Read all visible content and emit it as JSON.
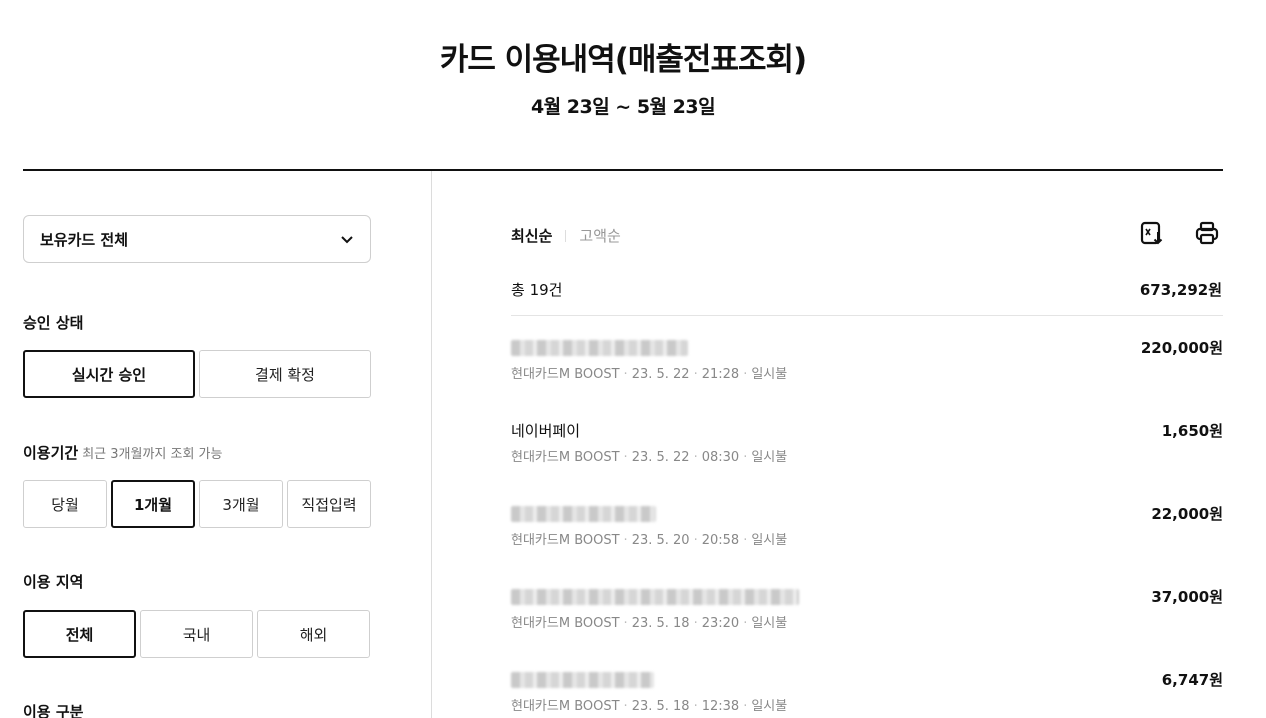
{
  "header": {
    "title": "카드 이용내역(매출전표조회)",
    "period": "4월 23일 ~ 5월 23일"
  },
  "sidebar": {
    "card_select": {
      "value": "보유카드 전체",
      "icon": "chevron-down-icon"
    },
    "approval": {
      "label": "승인 상태",
      "options": [
        "실시간 승인",
        "결제 확정"
      ],
      "selected": "실시간 승인"
    },
    "period": {
      "label": "이용기간",
      "hint": "최근 3개월까지 조회 가능",
      "options": [
        "당월",
        "1개월",
        "3개월",
        "직접입력"
      ],
      "selected": "1개월"
    },
    "region": {
      "label": "이용 지역",
      "options": [
        "전체",
        "국내",
        "해외"
      ],
      "selected": "전체"
    },
    "usage_type": {
      "label": "이용 구분"
    }
  },
  "main": {
    "sort": {
      "options": [
        "최신순",
        "고액순"
      ],
      "selected": "최신순"
    },
    "toolbar": {
      "excel_icon": "excel-download-icon",
      "print_icon": "printer-icon"
    },
    "total": {
      "label": "총 19건",
      "amount": "673,292원"
    },
    "transactions": [
      {
        "merchant": "",
        "merchant_blurred": true,
        "card": "현대카드M BOOST",
        "date": "23. 5. 22",
        "time": "21:28",
        "type": "일시불",
        "amount": "220,000원"
      },
      {
        "merchant": "네이버페이",
        "merchant_blurred": false,
        "card": "현대카드M BOOST",
        "date": "23. 5. 22",
        "time": "08:30",
        "type": "일시불",
        "amount": "1,650원"
      },
      {
        "merchant": "",
        "merchant_blurred": true,
        "card": "현대카드M BOOST",
        "date": "23. 5. 20",
        "time": "20:58",
        "type": "일시불",
        "amount": "22,000원"
      },
      {
        "merchant": "",
        "merchant_blurred": true,
        "card": "현대카드M BOOST",
        "date": "23. 5. 18",
        "time": "23:20",
        "type": "일시불",
        "amount": "37,000원"
      },
      {
        "merchant": "",
        "merchant_blurred": true,
        "card": "현대카드M BOOST",
        "date": "23. 5. 18",
        "time": "12:38",
        "type": "일시불",
        "amount": "6,747원"
      }
    ]
  }
}
